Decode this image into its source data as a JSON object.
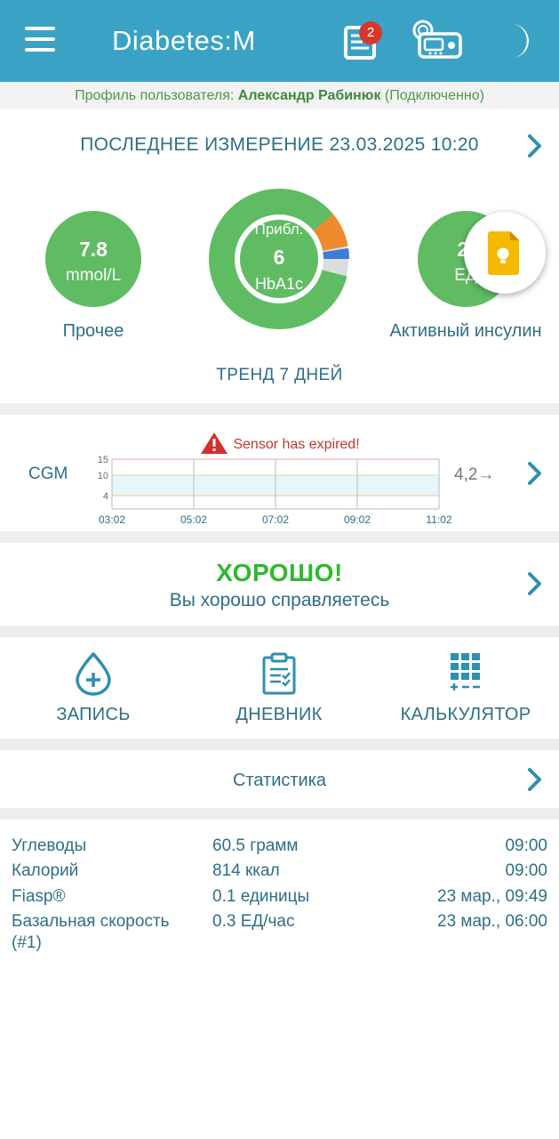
{
  "app": {
    "title": "Diabetes:M",
    "notification_count": "2",
    "icons": [
      "menu-icon",
      "journal-icon",
      "pump-icon",
      "night-mode-icon"
    ]
  },
  "profile": {
    "prefix": "Профиль пользователя:",
    "name": "Александр Рабинюк",
    "status": "(Подключенно)"
  },
  "last_measurement": {
    "title": "ПОСЛЕДНЕЕ ИЗМЕРЕНИЕ 23.03.2025 10:20",
    "glucose": {
      "value": "7.8",
      "unit": "mmol/L",
      "label": "Прочее"
    },
    "hba1c": {
      "prefix": "Прибл.",
      "value": "6",
      "unit": "HbA1c",
      "segments": {
        "in_range": 0.86,
        "high": 0.08,
        "low": 0.06
      }
    },
    "insulin": {
      "value": "2.",
      "unit": "ЕД",
      "label": "Активный инсулин"
    },
    "trend": "ТРЕНД 7 ДНЕЙ"
  },
  "cgm": {
    "warning": "Sensor has expired!",
    "label": "CGM",
    "last_value": "4,2→",
    "y_ticks": [
      "15",
      "10",
      "4"
    ],
    "x_ticks": [
      "03:02",
      "05:02",
      "07:02",
      "09:02",
      "11:02"
    ]
  },
  "status": {
    "title": "ХОРОШО!",
    "subtitle": "Вы хорошо справляетесь"
  },
  "actions": [
    {
      "label": "ЗАПИСЬ",
      "icon": "add-drop-icon"
    },
    {
      "label": "ДНЕВНИК",
      "icon": "clipboard-icon"
    },
    {
      "label": "КАЛЬКУЛЯТОР",
      "icon": "calculator-icon"
    }
  ],
  "statistics": {
    "label": "Статистика"
  },
  "summary": [
    {
      "name": "Углеводы",
      "value": "60.5 грамм",
      "time": "09:00"
    },
    {
      "name": "Калорий",
      "value": "814 ккал",
      "time": "09:00"
    },
    {
      "name": "Fiasp®",
      "value": "0.1 единицы",
      "time": "23 мар., 09:49"
    },
    {
      "name": "Базальная скорость (#1)",
      "value": "0.3 ЕД/час",
      "time": "23 мар., 06:00"
    }
  ],
  "colors": {
    "app_bar": "#3aa3c5",
    "glucose_green": "#5fbc62",
    "good_green": "#2eb82e",
    "high_orange": "#ef8a2e",
    "low_blue": "#3a7fd6",
    "accent_text": "#2e6e86",
    "warning_red": "#c0392b"
  }
}
